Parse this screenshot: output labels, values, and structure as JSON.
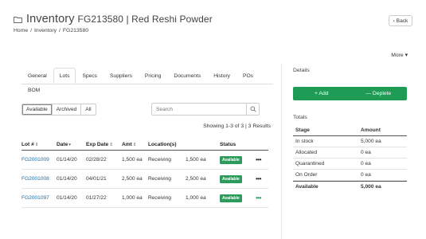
{
  "header": {
    "title": "Inventory",
    "sku": "FG213580 | Red Reshi Powder",
    "breadcrumb": [
      "Home",
      "/",
      "Inventory",
      "/",
      "FG213580"
    ],
    "back_label": "‹ Back"
  },
  "more_label": "More ▾",
  "tabs": [
    "General",
    "Lots",
    "Specs",
    "Suppliers",
    "Pricing",
    "Documents",
    "History",
    "POs",
    "BOM"
  ],
  "active_tab": "Lots",
  "filters": [
    "Available",
    "Archived",
    "All"
  ],
  "search": {
    "placeholder": "Search"
  },
  "showing": "Showing 1-3 of 3 | 3 Results",
  "table": {
    "columns": [
      "Lot #",
      "Date",
      "Exp Date",
      "Amt",
      "Location(s)",
      "Status"
    ],
    "rows": [
      {
        "lot": "FG2001009",
        "date": "01/14/20",
        "exp": "02/28/22",
        "amt": "1,500 ea",
        "location": "Receiving",
        "loc_amt": "1,500 ea",
        "status": "Available"
      },
      {
        "lot": "FG2001008",
        "date": "01/14/20",
        "exp": "04/01/21",
        "amt": "2,500 ea",
        "location": "Receiving",
        "loc_amt": "2,500 ea",
        "status": "Available"
      },
      {
        "lot": "FG2001097",
        "date": "01/14/20",
        "exp": "01/27/22",
        "amt": "1,000 ea",
        "location": "Receiving",
        "loc_amt": "1,000 ea",
        "status": "Available"
      }
    ],
    "row_menu": "•••"
  },
  "details": {
    "title": "Details",
    "add_label": "+ Add",
    "deplete_label": "— Deplete"
  },
  "totals": {
    "title": "Totals",
    "columns": [
      "Stage",
      "Amount"
    ],
    "rows": [
      {
        "stage": "In stock",
        "amount": "5,000 ea"
      },
      {
        "stage": "Allocated",
        "amount": "0 ea"
      },
      {
        "stage": "Quarantined",
        "amount": "0 ea"
      },
      {
        "stage": "On Order",
        "amount": "0 ea"
      }
    ],
    "total": {
      "stage": "Available",
      "amount": "5,000 ea"
    }
  },
  "colors": {
    "accent_green": "#1e9b54",
    "link_blue": "#1f6fa8"
  }
}
